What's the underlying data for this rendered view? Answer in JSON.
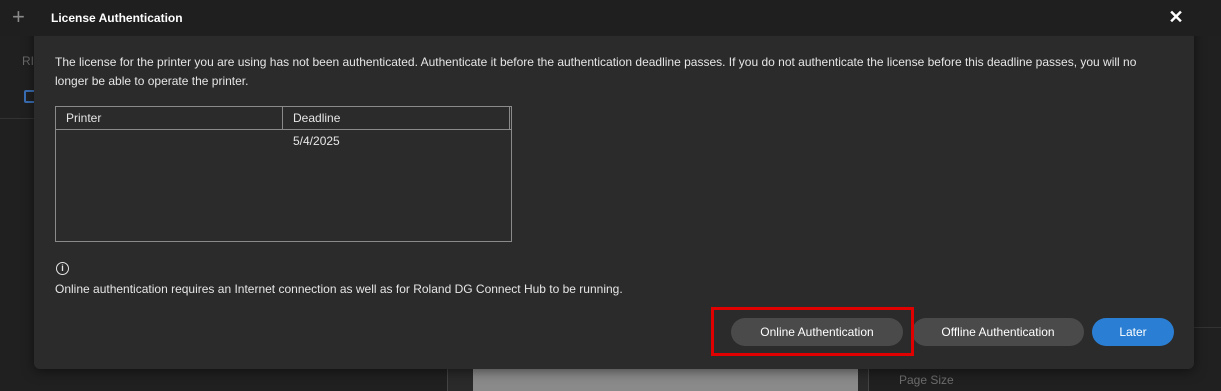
{
  "background": {
    "partial_label": "RI",
    "page_size_label": "Page Size"
  },
  "dialog": {
    "title": "License Authentication",
    "close_symbol": "✕",
    "message": "The license for the printer you are using has not been authenticated. Authenticate it before the authentication deadline passes. If you do not authenticate the license before this deadline passes, you will no longer be able to operate the printer.",
    "table": {
      "headers": [
        "Printer",
        "Deadline"
      ],
      "rows": [
        [
          "",
          "5/4/2025"
        ]
      ]
    },
    "info_symbol": "i",
    "note": "Online authentication requires an Internet connection as well as for Roland DG Connect Hub to be running.",
    "buttons": {
      "online": "Online Authentication",
      "offline": "Offline Authentication",
      "later": "Later"
    }
  },
  "colors": {
    "accent": "#2a7fd4",
    "highlight": "#e00000"
  }
}
